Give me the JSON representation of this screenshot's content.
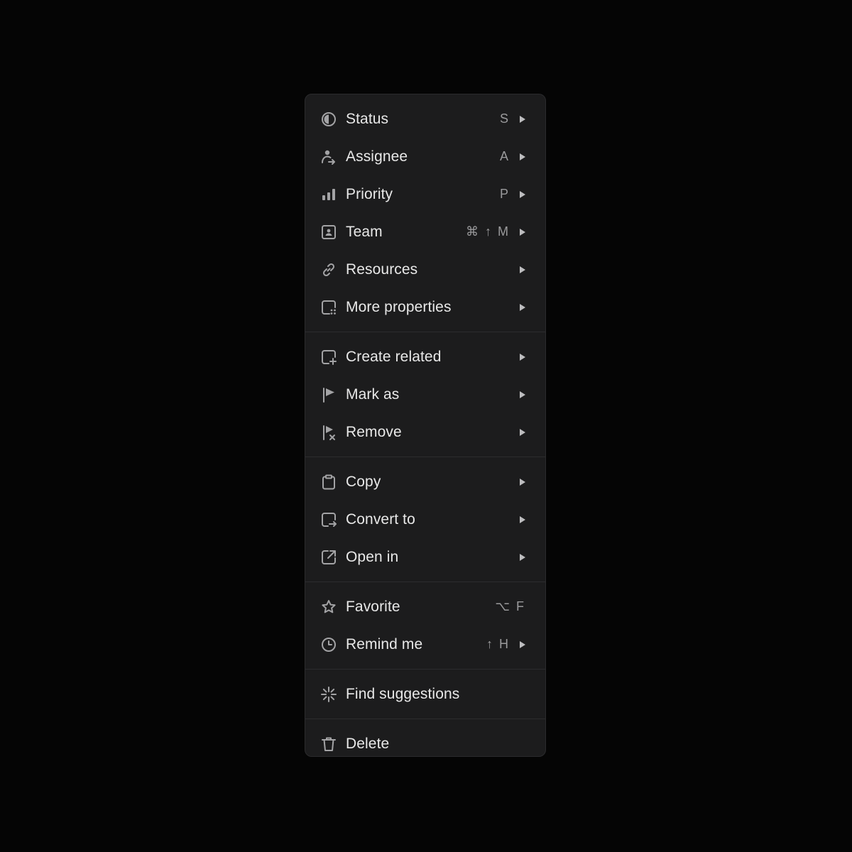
{
  "menu": {
    "groups": [
      {
        "items": [
          {
            "label": "Status",
            "icon": "half-circle-icon",
            "shortcut": "S",
            "submenu": true
          },
          {
            "label": "Assignee",
            "icon": "person-arrow-icon",
            "shortcut": "A",
            "submenu": true
          },
          {
            "label": "Priority",
            "icon": "bars-icon",
            "shortcut": "P",
            "submenu": true
          },
          {
            "label": "Team",
            "icon": "team-badge-icon",
            "shortcut": "⌘ ↑ M",
            "submenu": true
          },
          {
            "label": "Resources",
            "icon": "link-icon",
            "shortcut": "",
            "submenu": true
          },
          {
            "label": "More properties",
            "icon": "square-dots-icon",
            "shortcut": "",
            "submenu": true
          }
        ]
      },
      {
        "items": [
          {
            "label": "Create related",
            "icon": "square-plus-icon",
            "shortcut": "",
            "submenu": true
          },
          {
            "label": "Mark as",
            "icon": "flag-icon",
            "shortcut": "",
            "submenu": true
          },
          {
            "label": "Remove",
            "icon": "flag-x-icon",
            "shortcut": "",
            "submenu": true
          }
        ]
      },
      {
        "items": [
          {
            "label": "Copy",
            "icon": "clipboard-icon",
            "shortcut": "",
            "submenu": true
          },
          {
            "label": "Convert to",
            "icon": "square-arrow-icon",
            "shortcut": "",
            "submenu": true
          },
          {
            "label": "Open in",
            "icon": "external-link-icon",
            "shortcut": "",
            "submenu": true
          }
        ]
      },
      {
        "items": [
          {
            "label": "Favorite",
            "icon": "star-icon",
            "shortcut": "⌥ F",
            "submenu": false
          },
          {
            "label": "Remind me",
            "icon": "clock-icon",
            "shortcut": "↑ H",
            "submenu": true
          }
        ]
      },
      {
        "items": [
          {
            "label": "Find suggestions",
            "icon": "sparkle-icon",
            "shortcut": "",
            "submenu": false
          }
        ]
      },
      {
        "items": [
          {
            "label": "Delete",
            "icon": "trash-icon",
            "shortcut": "",
            "submenu": false
          }
        ]
      }
    ]
  },
  "colors": {
    "background": "#050505",
    "menu_bg": "#1c1c1d",
    "text": "#e8e8e8",
    "muted": "#9a9a9c",
    "icon": "#a0a0a2"
  }
}
